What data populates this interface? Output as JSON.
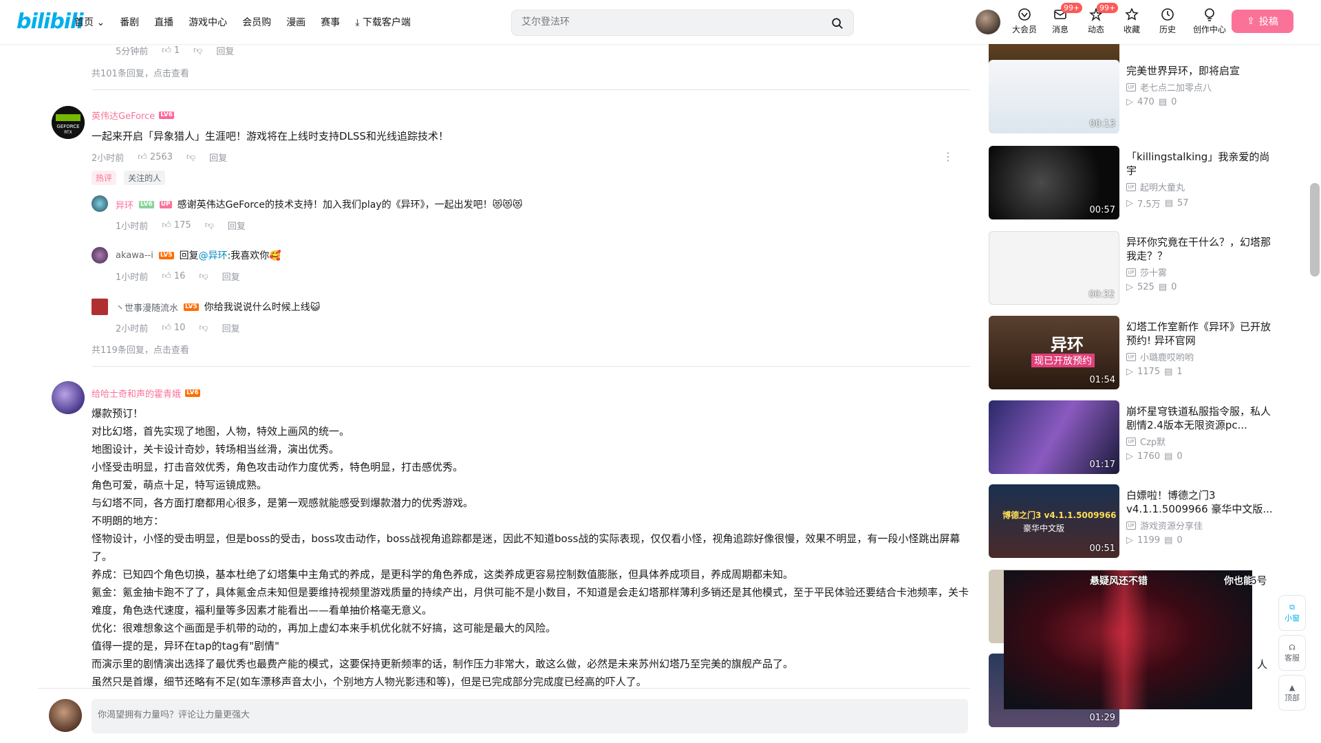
{
  "header": {
    "logo": "bilibili",
    "nav": [
      "首页",
      "番剧",
      "直播",
      "游戏中心",
      "会员购",
      "漫画",
      "赛事",
      "下载客户端"
    ],
    "search_placeholder": "艾尔登法环",
    "icons": [
      {
        "label": "大会员",
        "icon": "vip-icon",
        "badge": ""
      },
      {
        "label": "消息",
        "icon": "message-icon",
        "badge": "99+"
      },
      {
        "label": "动态",
        "icon": "dynamic-icon",
        "badge": "99+"
      },
      {
        "label": "收藏",
        "icon": "star-icon",
        "badge": ""
      },
      {
        "label": "历史",
        "icon": "clock-icon",
        "badge": ""
      },
      {
        "label": "创作中心",
        "icon": "bulb-icon",
        "badge": ""
      }
    ],
    "upload_label": "投稿"
  },
  "comments": {
    "top_tail": {
      "time": "5分钟前",
      "likes": "1",
      "reply": "回复",
      "more": "共101条回复，点击查看"
    },
    "c1": {
      "user": "英伟达GeForce",
      "level": "LV6",
      "text": "一起来开启「异象猎人」生涯吧！游戏将在上线时支持DLSS和光线追踪技术！",
      "time": "2小时前",
      "likes": "2563",
      "reply": "回复",
      "tags": [
        "热评",
        "关注的人"
      ],
      "subs": [
        {
          "user": "异环",
          "level": "LV6",
          "up": "UP",
          "text": "感谢英伟达GeForce的技术支持！加入我们play的《异环》，一起出发吧！😻😻😻",
          "time": "1小时前",
          "likes": "175",
          "reply": "回复"
        },
        {
          "user": "akawa--i",
          "level": "LV5",
          "text_prefix": "回复 ",
          "mention": "@异环",
          "text": " :我喜欢你🥰",
          "time": "1小时前",
          "likes": "16",
          "reply": "回复"
        },
        {
          "user": "丶世事漫随流水",
          "level": "LV5",
          "text": "你给我说说什么时候上线😺",
          "time": "2小时前",
          "likes": "10",
          "reply": "回复"
        }
      ],
      "more": "共119条回复，点击查看"
    },
    "c2": {
      "user": "给哈士奇和声的霍青娥",
      "level": "LV6",
      "lines": [
        "爆款预订！",
        "对比幻塔，首先实现了地图，人物，特效上画风的统一。",
        "地图设计，关卡设计奇妙，转场相当丝滑，演出优秀。",
        "小怪受击明显，打击音效优秀，角色攻击动作力度优秀，特色明显，打击感优秀。",
        "角色可爱，萌点十足，特写运镜成熟。",
        "与幻塔不同，各方面打磨都用心很多，是第一观感就能感受到爆款潜力的优秀游戏。",
        "不明朗的地方：",
        "怪物设计，小怪的受击明显，但是boss的受击，boss攻击动作，boss战视角追踪都是迷，因此不知道boss战的实际表现，仅仅看小怪，视角追踪好像很慢，效果不明显，有一段小怪跳出屏幕了。",
        "养成：已知四个角色切换，基本杜绝了幻塔集中主角式的养成，是更科学的角色养成，这类养成更容易控制数值膨胀，但具体养成项目，养成周期都未知。",
        "氪金：氪金抽卡跑不了了，具体氪金点未知但是要维持视频里游戏质量的持续产出，月供可能不是小数目，不知道是会走幻塔那样薄利多销还是其他模式，至于平民体验还要结合卡池频率，关卡难度，角色迭代速度，福利量等多因素才能看出——看单抽价格毫无意义。",
        "优化：很难想象这个画面是手机带的动的，再加上虚幻本来手机优化就不好搞，这可能是最大的风险。",
        "值得一提的是，异环在tap的tag有\"剧情\"",
        "而演示里的剧情演出选择了最优秀也最费产能的模式，这要保持更新频率的话，制作压力非常大，敢这么做，必然是未来苏州幻塔乃至完美的旗舰产品了。",
        "虽然只是首爆，细节还略有不足(如车漂移声音太小，个别地方人物光影违和等)，但是已完成部分完成度已经高的吓人了。"
      ]
    }
  },
  "comment_box": {
    "placeholder": "你渴望拥有力量吗？评论让力量更强大"
  },
  "sidebar": {
    "videos": [
      {
        "title": "完美世界异环，即将启宣",
        "up": "老七点二加零点八",
        "plays": "470",
        "danmaku": "0",
        "duration": "00:13"
      },
      {
        "title": "「killingstalking」我亲爱的尚宇",
        "up": "起明大童丸",
        "plays": "7.5万",
        "danmaku": "57",
        "duration": "00:57"
      },
      {
        "title": "异环你究竟在干什么？，幻塔那我走？？",
        "up": "莎十雾",
        "plays": "525",
        "danmaku": "0",
        "duration": "00:32"
      },
      {
        "title": "幻塔工作室新作《异环》已开放预约! 异环官网",
        "up": "小璐鹿哎哟哟",
        "plays": "1175",
        "danmaku": "1",
        "duration": "01:54",
        "overlay": "异环",
        "overlay2": "现已开放预约"
      },
      {
        "title": "崩坏星穹铁道私服指令服，私人剧情2.4版本无限资源pc...",
        "up": "Czp默",
        "plays": "1760",
        "danmaku": "0",
        "duration": "01:17"
      },
      {
        "title": "白嫖啦！博德之门3 v4.1.1.5009966 豪华中文版...",
        "up": "游戏资源分享佳",
        "plays": "1199",
        "danmaku": "0",
        "duration": "00:51",
        "overlay": "博德之门3 v4.1.1.5009966",
        "overlay2": "豪华中文版"
      },
      {
        "title": "6号",
        "up": "",
        "plays": "",
        "danmaku": "",
        "duration": ""
      },
      {
        "title": "人",
        "up": "",
        "plays": "",
        "danmaku": "",
        "duration": "01:29"
      }
    ]
  },
  "miniplayer": {
    "danmaku_1": "悬疑风还不错",
    "danmaku_2": "你也能"
  },
  "side_buttons": [
    "小窗",
    "客服",
    "顶部"
  ],
  "colors": {
    "brand_pink": "#fb7299",
    "brand_blue": "#00aeec",
    "link": "#008ac5"
  }
}
